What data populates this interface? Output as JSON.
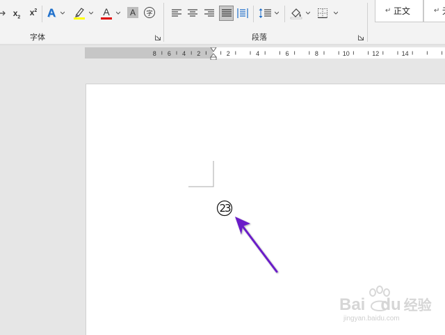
{
  "ribbon": {
    "font_group_label": "字体",
    "paragraph_group_label": "段落",
    "subscript_label": "x",
    "subscript_mark": "2",
    "superscript_label": "x",
    "superscript_mark": "2",
    "text_effects_label": "A",
    "font_color_label": "A",
    "char_shading_label": "A",
    "enclosed_char_label": "字",
    "highlight_color": "#ffff00",
    "font_color": "#e00000",
    "styles": [
      {
        "label": "正文"
      },
      {
        "label": "无"
      }
    ]
  },
  "ruler": {
    "left_numbers": [
      "8",
      "6",
      "4",
      "2"
    ],
    "right_numbers": [
      "2",
      "4",
      "6",
      "8",
      "10",
      "12",
      "14"
    ]
  },
  "document": {
    "enclosed_text": "23"
  },
  "annotation": {
    "arrow_color": "#6a1fc8"
  },
  "watermark": {
    "brand": "Bai",
    "brand_end": "du",
    "brand_cn": "经验",
    "url": "jingyan.baidu.com"
  }
}
